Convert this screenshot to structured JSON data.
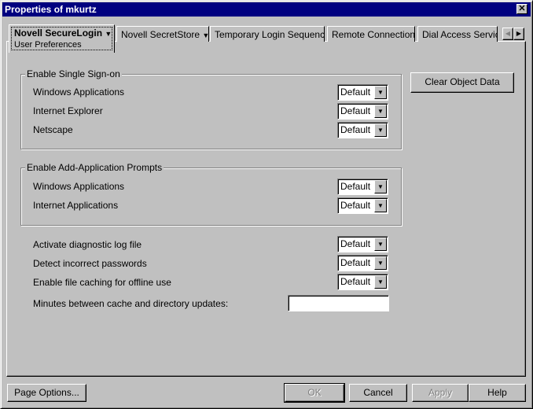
{
  "window": {
    "title": "Properties of mkurtz"
  },
  "tabs": [
    {
      "label": "Novell SecureLogin",
      "sub": "User Preferences"
    },
    {
      "label": "Novell SecretStore"
    },
    {
      "label": "Temporary Login Sequence"
    },
    {
      "label": "Remote Connections"
    },
    {
      "label": "Dial Access Servic"
    }
  ],
  "sso": {
    "title": "Enable Single Sign-on",
    "rows": [
      {
        "label": "Windows Applications",
        "value": "Default"
      },
      {
        "label": "Internet Explorer",
        "value": "Default"
      },
      {
        "label": "Netscape",
        "value": "Default"
      }
    ]
  },
  "prompts": {
    "title": "Enable Add-Application Prompts",
    "rows": [
      {
        "label": "Windows Applications",
        "value": "Default"
      },
      {
        "label": "Internet Applications",
        "value": "Default"
      }
    ]
  },
  "misc": [
    {
      "label": "Activate diagnostic log file",
      "value": "Default"
    },
    {
      "label": "Detect incorrect passwords",
      "value": "Default"
    },
    {
      "label": "Enable file caching for offline use",
      "value": "Default"
    }
  ],
  "minutes": {
    "label": "Minutes between cache and directory updates:",
    "value": ""
  },
  "buttons": {
    "clear": "Clear Object Data",
    "page_options": "Page Options...",
    "ok": "OK",
    "cancel": "Cancel",
    "apply": "Apply",
    "help": "Help"
  }
}
